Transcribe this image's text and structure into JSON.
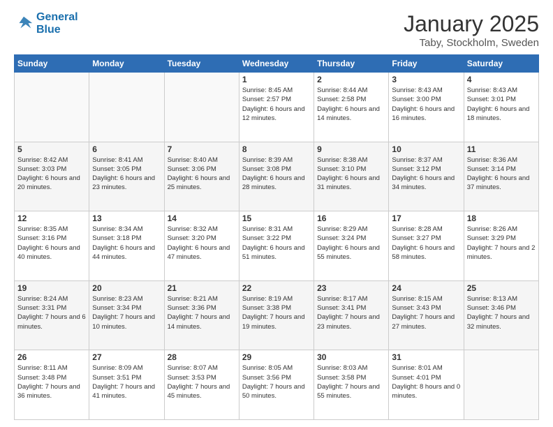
{
  "logo": {
    "line1": "General",
    "line2": "Blue"
  },
  "calendar": {
    "title": "January 2025",
    "subtitle": "Taby, Stockholm, Sweden",
    "days_of_week": [
      "Sunday",
      "Monday",
      "Tuesday",
      "Wednesday",
      "Thursday",
      "Friday",
      "Saturday"
    ],
    "weeks": [
      [
        {
          "day": "",
          "info": ""
        },
        {
          "day": "",
          "info": ""
        },
        {
          "day": "",
          "info": ""
        },
        {
          "day": "1",
          "info": "Sunrise: 8:45 AM\nSunset: 2:57 PM\nDaylight: 6 hours\nand 12 minutes."
        },
        {
          "day": "2",
          "info": "Sunrise: 8:44 AM\nSunset: 2:58 PM\nDaylight: 6 hours\nand 14 minutes."
        },
        {
          "day": "3",
          "info": "Sunrise: 8:43 AM\nSunset: 3:00 PM\nDaylight: 6 hours\nand 16 minutes."
        },
        {
          "day": "4",
          "info": "Sunrise: 8:43 AM\nSunset: 3:01 PM\nDaylight: 6 hours\nand 18 minutes."
        }
      ],
      [
        {
          "day": "5",
          "info": "Sunrise: 8:42 AM\nSunset: 3:03 PM\nDaylight: 6 hours\nand 20 minutes."
        },
        {
          "day": "6",
          "info": "Sunrise: 8:41 AM\nSunset: 3:05 PM\nDaylight: 6 hours\nand 23 minutes."
        },
        {
          "day": "7",
          "info": "Sunrise: 8:40 AM\nSunset: 3:06 PM\nDaylight: 6 hours\nand 25 minutes."
        },
        {
          "day": "8",
          "info": "Sunrise: 8:39 AM\nSunset: 3:08 PM\nDaylight: 6 hours\nand 28 minutes."
        },
        {
          "day": "9",
          "info": "Sunrise: 8:38 AM\nSunset: 3:10 PM\nDaylight: 6 hours\nand 31 minutes."
        },
        {
          "day": "10",
          "info": "Sunrise: 8:37 AM\nSunset: 3:12 PM\nDaylight: 6 hours\nand 34 minutes."
        },
        {
          "day": "11",
          "info": "Sunrise: 8:36 AM\nSunset: 3:14 PM\nDaylight: 6 hours\nand 37 minutes."
        }
      ],
      [
        {
          "day": "12",
          "info": "Sunrise: 8:35 AM\nSunset: 3:16 PM\nDaylight: 6 hours\nand 40 minutes."
        },
        {
          "day": "13",
          "info": "Sunrise: 8:34 AM\nSunset: 3:18 PM\nDaylight: 6 hours\nand 44 minutes."
        },
        {
          "day": "14",
          "info": "Sunrise: 8:32 AM\nSunset: 3:20 PM\nDaylight: 6 hours\nand 47 minutes."
        },
        {
          "day": "15",
          "info": "Sunrise: 8:31 AM\nSunset: 3:22 PM\nDaylight: 6 hours\nand 51 minutes."
        },
        {
          "day": "16",
          "info": "Sunrise: 8:29 AM\nSunset: 3:24 PM\nDaylight: 6 hours\nand 55 minutes."
        },
        {
          "day": "17",
          "info": "Sunrise: 8:28 AM\nSunset: 3:27 PM\nDaylight: 6 hours\nand 58 minutes."
        },
        {
          "day": "18",
          "info": "Sunrise: 8:26 AM\nSunset: 3:29 PM\nDaylight: 7 hours\nand 2 minutes."
        }
      ],
      [
        {
          "day": "19",
          "info": "Sunrise: 8:24 AM\nSunset: 3:31 PM\nDaylight: 7 hours\nand 6 minutes."
        },
        {
          "day": "20",
          "info": "Sunrise: 8:23 AM\nSunset: 3:34 PM\nDaylight: 7 hours\nand 10 minutes."
        },
        {
          "day": "21",
          "info": "Sunrise: 8:21 AM\nSunset: 3:36 PM\nDaylight: 7 hours\nand 14 minutes."
        },
        {
          "day": "22",
          "info": "Sunrise: 8:19 AM\nSunset: 3:38 PM\nDaylight: 7 hours\nand 19 minutes."
        },
        {
          "day": "23",
          "info": "Sunrise: 8:17 AM\nSunset: 3:41 PM\nDaylight: 7 hours\nand 23 minutes."
        },
        {
          "day": "24",
          "info": "Sunrise: 8:15 AM\nSunset: 3:43 PM\nDaylight: 7 hours\nand 27 minutes."
        },
        {
          "day": "25",
          "info": "Sunrise: 8:13 AM\nSunset: 3:46 PM\nDaylight: 7 hours\nand 32 minutes."
        }
      ],
      [
        {
          "day": "26",
          "info": "Sunrise: 8:11 AM\nSunset: 3:48 PM\nDaylight: 7 hours\nand 36 minutes."
        },
        {
          "day": "27",
          "info": "Sunrise: 8:09 AM\nSunset: 3:51 PM\nDaylight: 7 hours\nand 41 minutes."
        },
        {
          "day": "28",
          "info": "Sunrise: 8:07 AM\nSunset: 3:53 PM\nDaylight: 7 hours\nand 45 minutes."
        },
        {
          "day": "29",
          "info": "Sunrise: 8:05 AM\nSunset: 3:56 PM\nDaylight: 7 hours\nand 50 minutes."
        },
        {
          "day": "30",
          "info": "Sunrise: 8:03 AM\nSunset: 3:58 PM\nDaylight: 7 hours\nand 55 minutes."
        },
        {
          "day": "31",
          "info": "Sunrise: 8:01 AM\nSunset: 4:01 PM\nDaylight: 8 hours\nand 0 minutes."
        },
        {
          "day": "",
          "info": ""
        }
      ]
    ]
  }
}
